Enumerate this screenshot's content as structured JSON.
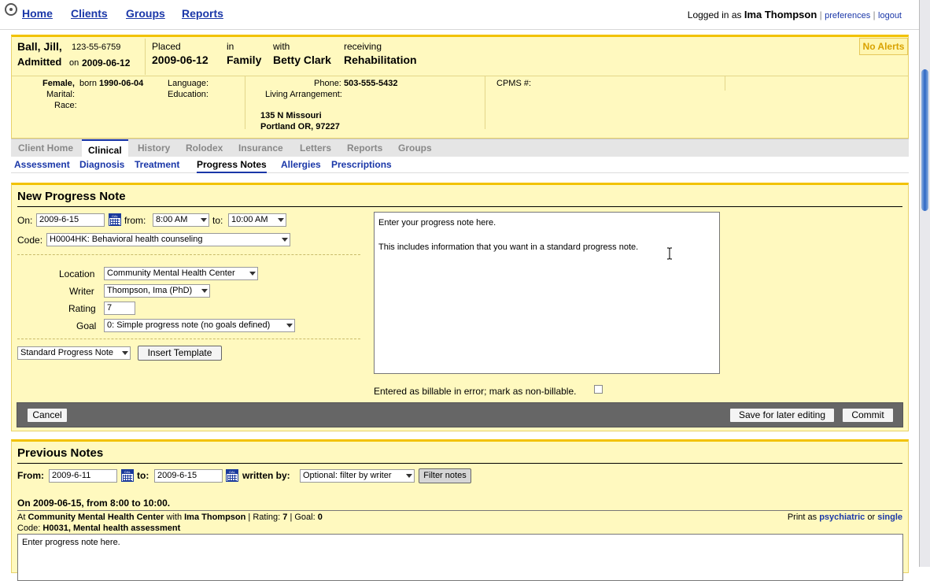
{
  "nav": {
    "home": "Home",
    "clients": "Clients",
    "groups": "Groups",
    "reports": "Reports"
  },
  "login": {
    "prefix": "Logged in as",
    "user": "Ima Thompson",
    "preferences": "preferences",
    "sep": "|",
    "logout": "logout"
  },
  "client": {
    "name": "Ball, Jill,",
    "id": "123-55-6759",
    "admitted_label": "Admitted",
    "on_label": "on",
    "admitted_date": "2009-06-12",
    "placed_label": "Placed",
    "placed_date": "2009-06-12",
    "in_label": "in",
    "in_value": "Family",
    "with_label": "with",
    "with_value": "Betty Clark",
    "receiving_label": "receiving",
    "receiving_value": "Rehabilitation",
    "sex": "Female,",
    "born_label": "born",
    "born": "1990-06-04",
    "marital_label": "Marital:",
    "race_label": "Race:",
    "language_label": "Language:",
    "education_label": "Education:",
    "phone_label": "Phone:",
    "phone": "503-555-5432",
    "living_label": "Living Arrangement:",
    "address1": "135 N Missouri",
    "address2": "Portland OR, 97227",
    "cpms_label": "CPMS #:"
  },
  "alerts": "No Alerts",
  "tabs": [
    "Client Home",
    "Clinical",
    "History",
    "Rolodex",
    "Insurance",
    "Letters",
    "Reports",
    "Groups"
  ],
  "subtabs": [
    "Assessment",
    "Diagnosis",
    "Treatment",
    "Progress Notes",
    "Allergies",
    "Prescriptions"
  ],
  "form": {
    "title": "New Progress Note",
    "on_label": "On:",
    "on_value": "2009-6-15",
    "from_label": "from:",
    "from_value": "8:00 AM",
    "to_label": "to:",
    "to_value": "10:00 AM",
    "code_label": "Code:",
    "code_value": "H0004HK: Behavioral health counseling",
    "location_label": "Location",
    "location_value": "Community Mental Health Center",
    "writer_label": "Writer",
    "writer_value": "Thompson, Ima (PhD)",
    "rating_label": "Rating",
    "rating_value": "7",
    "goal_label": "Goal",
    "goal_value": "0: Simple progress note (no goals defined)",
    "template_value": "Standard Progress Note",
    "insert_template": "Insert Template",
    "note_text": "Enter your progress note here.\n\nThis includes information that you want in a standard progress note.",
    "billable_text": "Entered as billable in error; mark as non-billable.",
    "cancel": "Cancel",
    "save_later": "Save for later editing",
    "commit": "Commit",
    "cal_text": "CAL"
  },
  "previous": {
    "title": "Previous Notes",
    "from_label": "From:",
    "from_value": "2009-6-11",
    "to_label": "to:",
    "to_value": "2009-6-15",
    "written_label": "written by:",
    "written_value": "Optional: filter by writer",
    "filter_button": "Filter notes",
    "entry_heading": "On 2009-06-15, from 8:00 to 10:00.",
    "at_label": "At",
    "location": "Community Mental Health Center",
    "with_label": "with",
    "writer": "Ima Thompson",
    "rating_text": "| Rating:",
    "rating": "7",
    "goal_text": "| Goal:",
    "goal": "0",
    "code_label": "Code:",
    "code": "H0031, Mental health assessment",
    "print_label": "Print as",
    "psychiatric": "psychiatric",
    "or_label": "or",
    "single": "single",
    "note_text": "Enter progress note here."
  },
  "colors": {
    "link": "#1a37a8",
    "panel": "#fff9bf",
    "panel_top": "#f2c200",
    "alert": "#d9a200",
    "bar": "#666666"
  }
}
